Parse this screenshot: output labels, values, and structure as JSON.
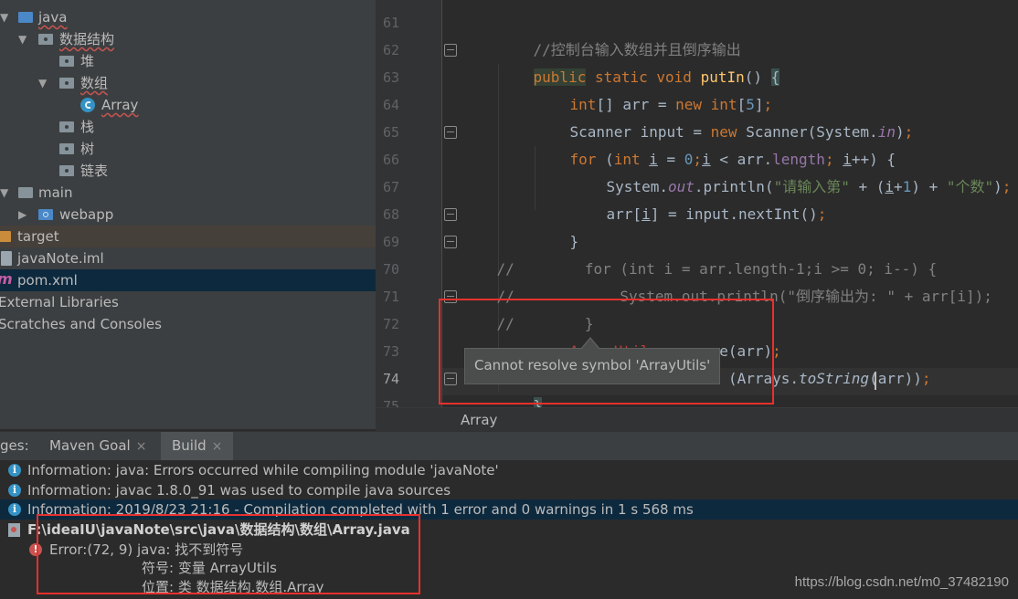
{
  "project_tree": [
    {
      "label": "java",
      "arrow": "▼",
      "icon": "source-folder-icon",
      "squiggle": true
    },
    {
      "label": "数据结构",
      "arrow": "▼",
      "icon": "package-icon",
      "squiggle": true
    },
    {
      "label": "堆",
      "arrow": "",
      "icon": "package-icon"
    },
    {
      "label": "数组",
      "arrow": "▼",
      "icon": "package-icon",
      "squiggle": true
    },
    {
      "label": "Array",
      "arrow": "",
      "icon": "java-class-icon",
      "squiggle": true
    },
    {
      "label": "栈",
      "arrow": "",
      "icon": "package-icon"
    },
    {
      "label": "树",
      "arrow": "",
      "icon": "package-icon"
    },
    {
      "label": "链表",
      "arrow": "",
      "icon": "package-icon"
    },
    {
      "label": "main",
      "arrow": "▼",
      "icon": "folder-icon"
    },
    {
      "label": "webapp",
      "arrow": "▶",
      "icon": "web-folder-icon"
    },
    {
      "label": "target",
      "arrow": "",
      "icon": "excluded-folder-icon"
    },
    {
      "label": "javaNote.iml",
      "arrow": "",
      "icon": "iml-file-icon"
    },
    {
      "label": "pom.xml",
      "arrow": "",
      "icon": "maven-file-icon"
    },
    {
      "label": "External Libraries",
      "arrow": "",
      "icon": ""
    },
    {
      "label": "Scratches and Consoles",
      "arrow": "",
      "icon": ""
    }
  ],
  "editor": {
    "line_numbers": [
      "61",
      "62",
      "63",
      "64",
      "65",
      "66",
      "67",
      "68",
      "69",
      "70",
      "71",
      "72",
      "73",
      "74",
      "75"
    ],
    "current_line": "74",
    "code": {
      "l61_comment": "//控制台输入数组并且倒序输出",
      "l62_public": "public",
      "l62_static": " static void ",
      "l62_fn": "putIn",
      "l62_paren": "() ",
      "l62_brace": "{",
      "l63_int": "int",
      "l63_mid": "[] arr = ",
      "l63_new": "new int",
      "l63_br1": "[",
      "l63_num": "5",
      "l63_br2": "]",
      "l63_semi": ";",
      "l64_a": "Scanner input = ",
      "l64_new": "new ",
      "l64_b": "Scanner(System.",
      "l64_in": "in",
      "l64_c": ")",
      "l64_semi": ";",
      "l65_for": "for ",
      "l65_a": "(",
      "l65_int": "int ",
      "l65_i": "i",
      "l65_b": " = ",
      "l65_num0": "0",
      "l65_semi1": ";",
      "l65_i2": "i",
      "l65_c": " < arr.",
      "l65_len": "length",
      "l65_semi2": "; ",
      "l65_i3": "i",
      "l65_d": "++) {",
      "l66_a": "System.",
      "l66_out": "out",
      "l66_b": ".println(",
      "l66_str1": "\"请输入第\"",
      "l66_c": " + (",
      "l66_i": "i",
      "l66_d": "+",
      "l66_num1": "1",
      "l66_e": ") + ",
      "l66_str2": "\"个数\"",
      "l66_f": ")",
      "l66_semi": ";",
      "l67_a": "arr[",
      "l67_i": "i",
      "l67_b": "] = input.nextInt()",
      "l67_semi": ";",
      "l68": "}",
      "l69": "//        for (int i = arr.length-1;i >= 0; i--) {",
      "l70": "//            System.out.println(\"倒序输出为: \" + arr[i]);",
      "l71": "//        }",
      "l72_err": "ArrayUtils",
      "l72_b": ".reverse(arr)",
      "l72_semi": ";",
      "l73_a": "S",
      "l73_b": "                 ",
      "l73_c": "(Arrays.",
      "l73_to": "toString",
      "l73_d": "(arr))",
      "l73_semi": ";",
      "l74": "}"
    },
    "tooltip": "Cannot resolve symbol 'ArrayUtils'"
  },
  "breadcrumb": "Array",
  "bottom_panel": {
    "tabs_prefix": "ges:",
    "tabs": [
      {
        "label": "Maven Goal",
        "close": "×"
      },
      {
        "label": "Build",
        "close": "×"
      }
    ],
    "messages": [
      "Information: java: Errors occurred while compiling module 'javaNote'",
      "Information: javac 1.8.0_91 was used to compile java sources",
      "Information: 2019/8/23 21:16 - Compilation completed with 1 error and 0 warnings in 1 s 568 ms"
    ],
    "file_path": "F:\\ideaIU\\javaNote\\src\\java\\数据结构\\数组\\Array.java",
    "error_line": "Error:(72, 9)  java: 找不到符号",
    "symbol_line": "符号:   变量 ArrayUtils",
    "location_line": "位置: 类 数据结构.数组.Array"
  },
  "watermark": "https://blog.csdn.net/m0_37482190",
  "colors": {
    "annotation_red": "#e8302c",
    "error_red": "#bc3f3c",
    "keyword": "#cc7832",
    "selection_blue": "#0d293e"
  }
}
